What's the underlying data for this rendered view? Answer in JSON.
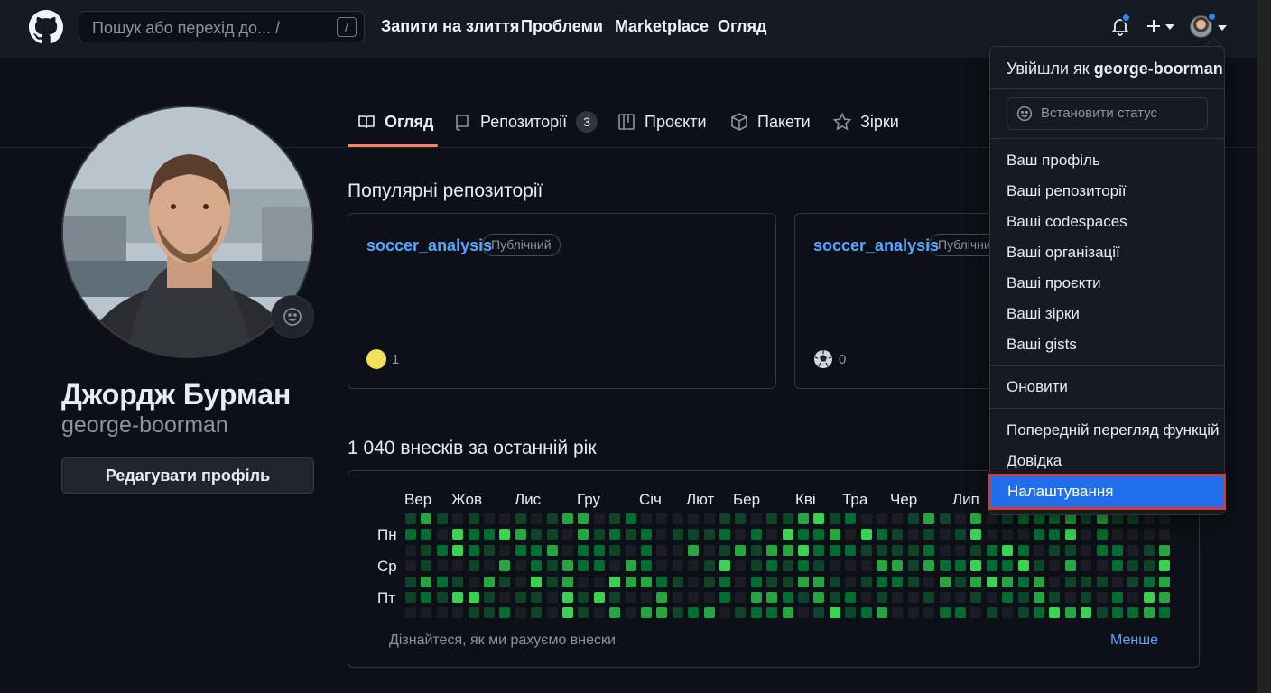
{
  "header": {
    "search_placeholder": "Пошук або перехід до... /",
    "search_key": "/",
    "nav": [
      "Запити на злиття",
      "Проблеми",
      "Marketplace",
      "Огляд"
    ]
  },
  "profile": {
    "display_name": "Джордж Бурман",
    "login": "george-boorman",
    "edit_button": "Редагувати профіль"
  },
  "tabs": [
    {
      "label": "Огляд",
      "icon": "book-icon"
    },
    {
      "label": "Репозиторії",
      "icon": "repo-icon",
      "count": "3"
    },
    {
      "label": "Проєкти",
      "icon": "table-icon"
    },
    {
      "label": "Пакети",
      "icon": "package-icon"
    },
    {
      "label": "Зірки",
      "icon": "star-icon"
    }
  ],
  "popular": {
    "title": "Популярні репозиторії",
    "repos": [
      {
        "name": "soccer_analysis",
        "visibility": "Публічний",
        "stars": "1"
      },
      {
        "name": "soccer_analysis",
        "visibility": "Публічний",
        "stars": "0"
      }
    ]
  },
  "contributions": {
    "title": "1 040 внесків за останній рік",
    "months": [
      "Вер",
      "Жов",
      "Лис",
      "Гру",
      "Січ",
      "Лют",
      "Бер",
      "Кві",
      "Тра",
      "Чер",
      "Лип"
    ],
    "days": [
      "Пн",
      "Ср",
      "Пт"
    ],
    "footer": "Дізнайтеся, як ми рахуємо внески",
    "legend_less": "Менше",
    "colors": [
      "#1a1e24",
      "#0e4429",
      "#006d32",
      "#26a641",
      "#39d353"
    ]
  },
  "dropdown": {
    "signed_in_prefix": "Увійшли як",
    "signed_in_user": "george-boorman",
    "status_placeholder": "Встановити статус",
    "group1": [
      "Ваш профіль",
      "Ваші репозиторії",
      "Ваші codespaces",
      "Ваші організації",
      "Ваші проєкти",
      "Ваші зірки",
      "Ваші gists"
    ],
    "upgrade": "Оновити",
    "group2": [
      "Попередній перегляд функцій",
      "Довідка"
    ],
    "settings": "Налаштування"
  }
}
